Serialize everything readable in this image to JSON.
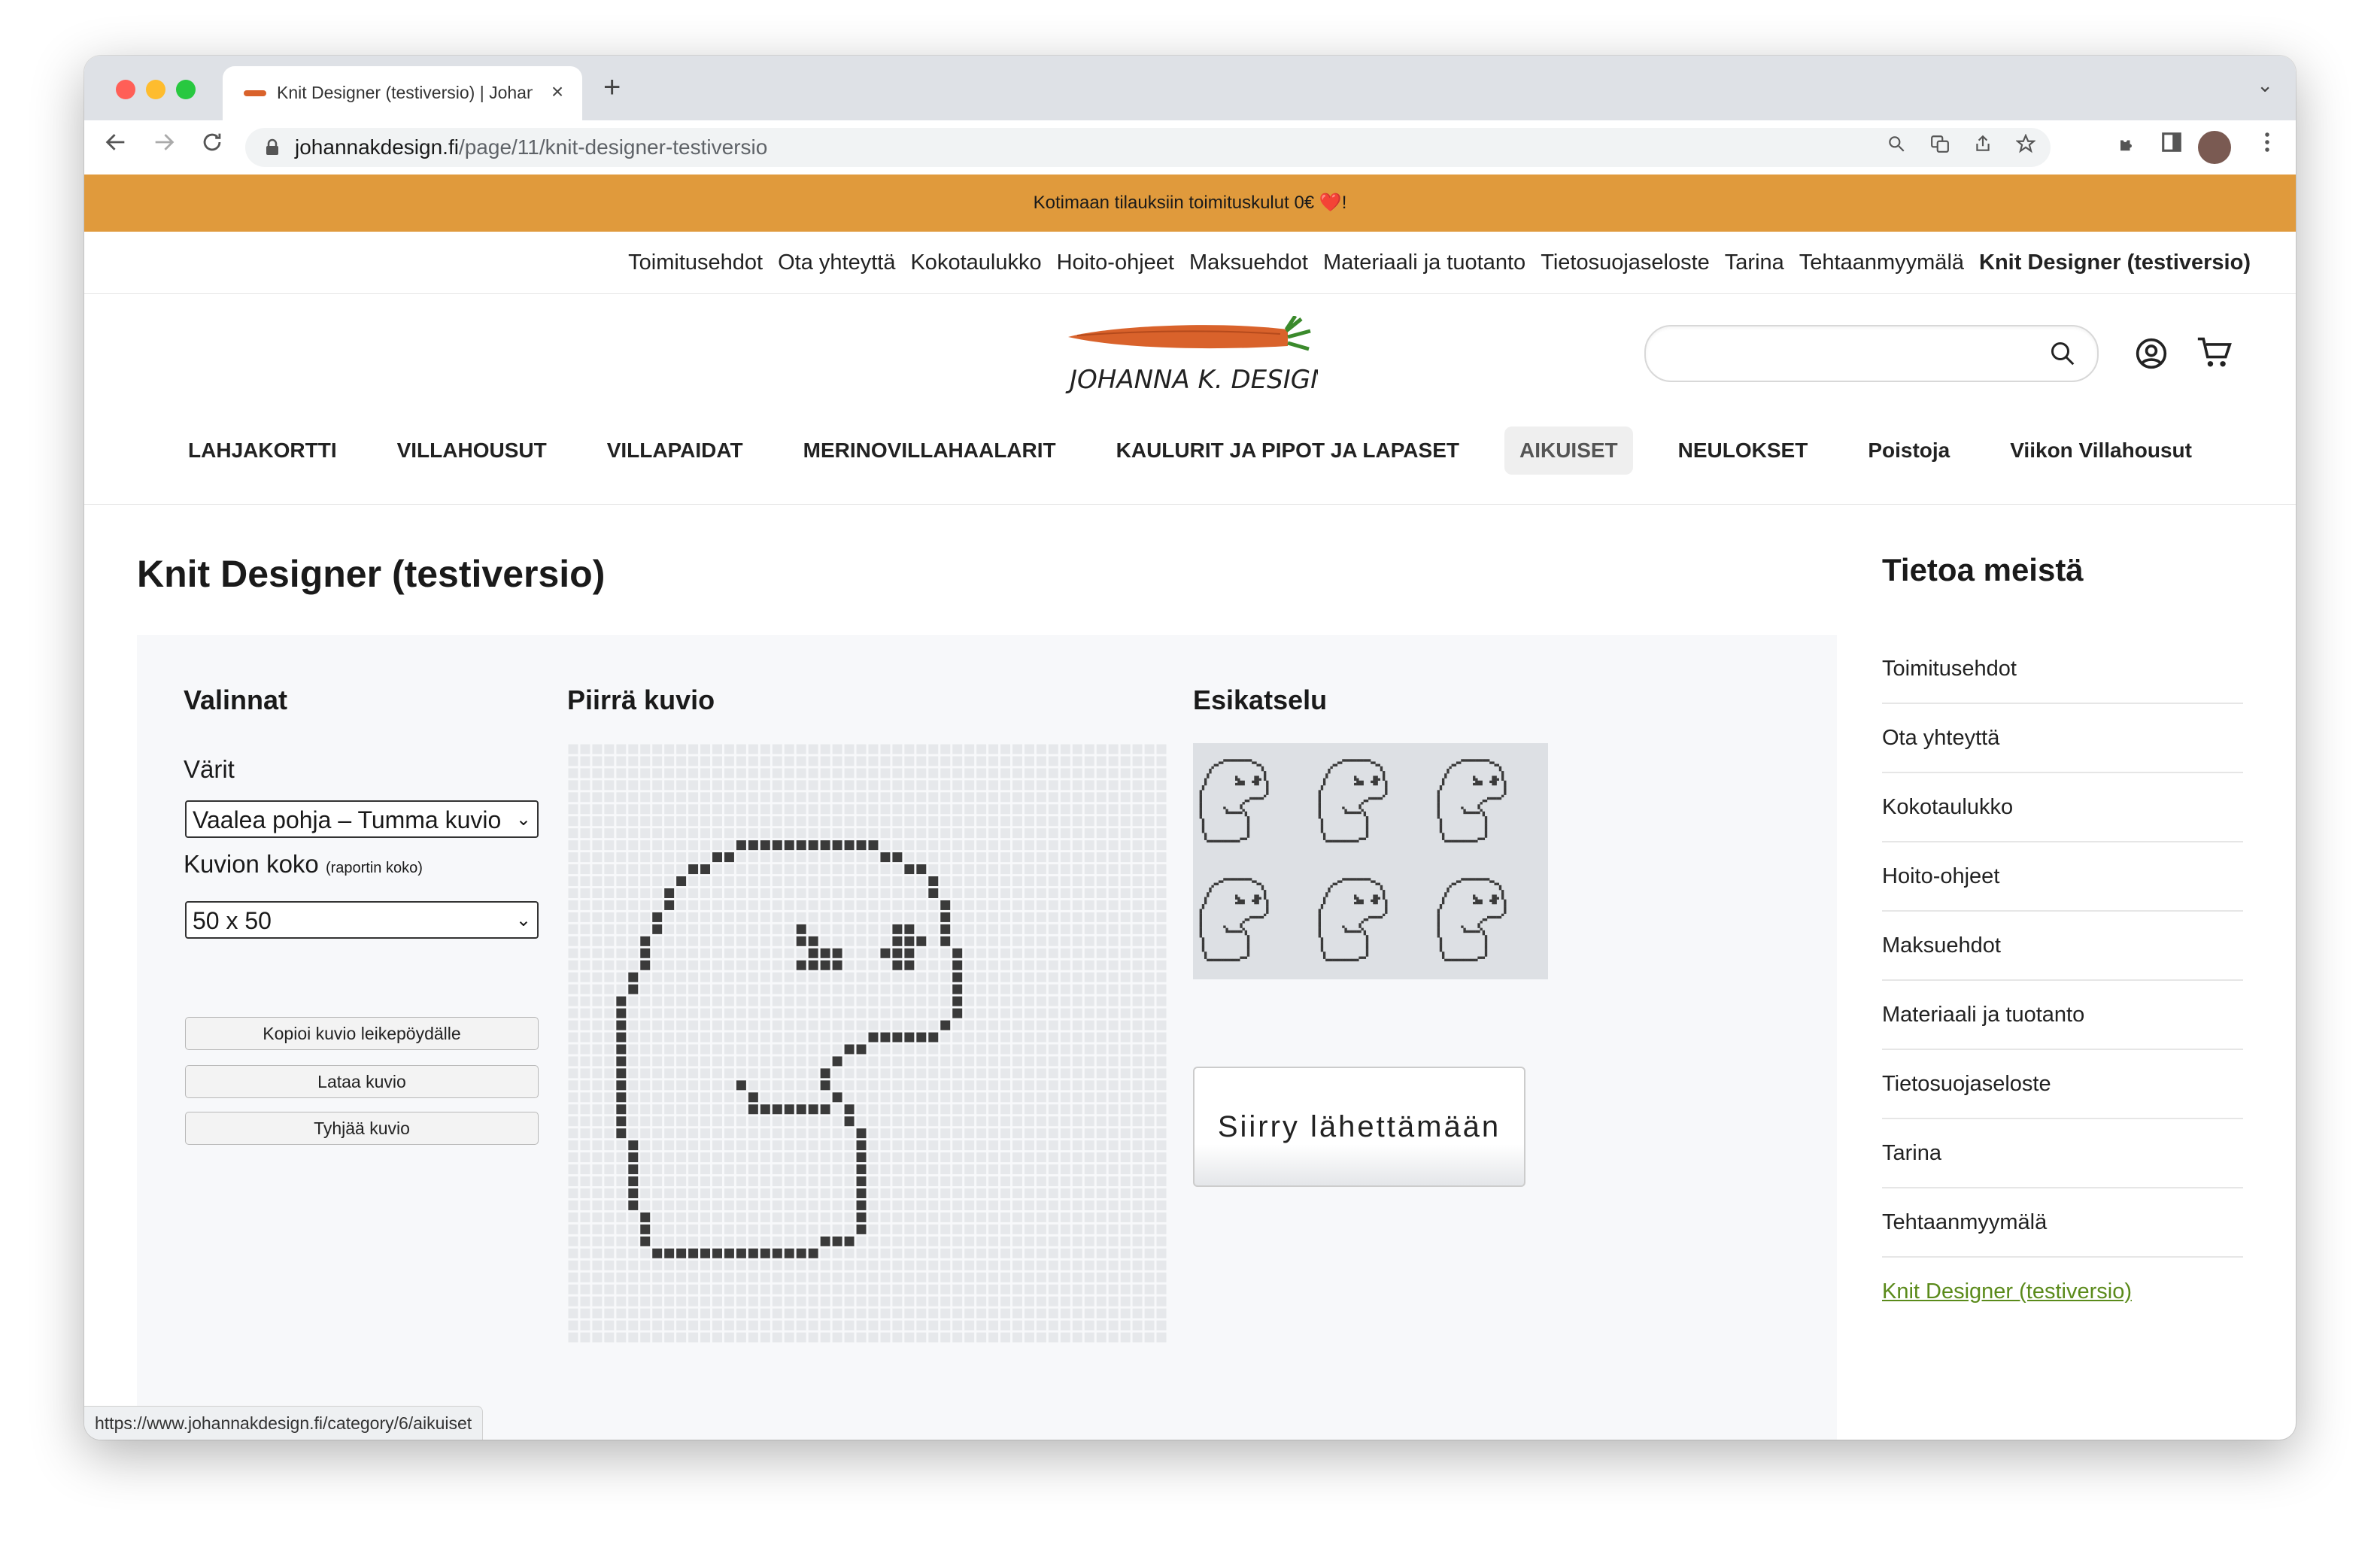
{
  "browser": {
    "tab_title": "Knit Designer (testiversio) | Johanna K. Design",
    "tab_close": "×",
    "new_tab": "+",
    "tab_menu": "⌄",
    "url_domain": "johannakdesign.fi",
    "url_path": "/page/11/knit-designer-testiversio",
    "status_url": "https://www.johannakdesign.fi/category/6/aikuiset"
  },
  "banner": {
    "text": "Kotimaan tilauksiin toimituskulut 0€ ❤️!"
  },
  "top_links": [
    "Toimitusehdot",
    "Ota yhteyttä",
    "Kokotaulukko",
    "Hoito-ohjeet",
    "Maksuehdot",
    "Materiaali ja tuotanto",
    "Tietosuojaseloste",
    "Tarina",
    "Tehtaanmyymälä",
    "Knit Designer (testiversio)"
  ],
  "logo_text": "JOHANNA K. DESIGN",
  "search": {
    "placeholder": ""
  },
  "main_nav": [
    "LAHJAKORTTI",
    "VILLAHOUSUT",
    "VILLAPAIDAT",
    "MERINOVILLAHAALARIT",
    "KAULURIT JA PIPOT JA LAPASET",
    "AIKUISET",
    "NEULOKSET",
    "Poistoja",
    "Viikon Villahousut"
  ],
  "page": {
    "title": "Knit Designer (testiversio)"
  },
  "designer": {
    "options_title": "Valinnat",
    "colors_label": "Värit",
    "colors_value": "Vaalea pohja – Tumma kuvio",
    "size_label": "Kuvion koko",
    "size_note": "(raportin koko)",
    "size_value": "50 x 50",
    "copy_button": "Kopioi kuvio leikepöydälle",
    "load_button": "Lataa kuvio",
    "clear_button": "Tyhjää kuvio",
    "draw_title": "Piirrä kuvio",
    "preview_title": "Esikatselu",
    "submit_button": "Siirry lähettämään",
    "grid_size": 50,
    "light_color": "#e6e8eb",
    "dark_color": "#3a3a3a"
  },
  "sidebar": {
    "title": "Tietoa meistä",
    "items": [
      "Toimitusehdot",
      "Ota yhteyttä",
      "Kokotaulukko",
      "Hoito-ohjeet",
      "Maksuehdot",
      "Materiaali ja tuotanto",
      "Tietosuojaseloste",
      "Tarina",
      "Tehtaanmyymälä",
      "Knit Designer (testiversio)"
    ]
  },
  "colors": {
    "banner": "#e09a3c",
    "accent_link": "#5a8a1a"
  }
}
